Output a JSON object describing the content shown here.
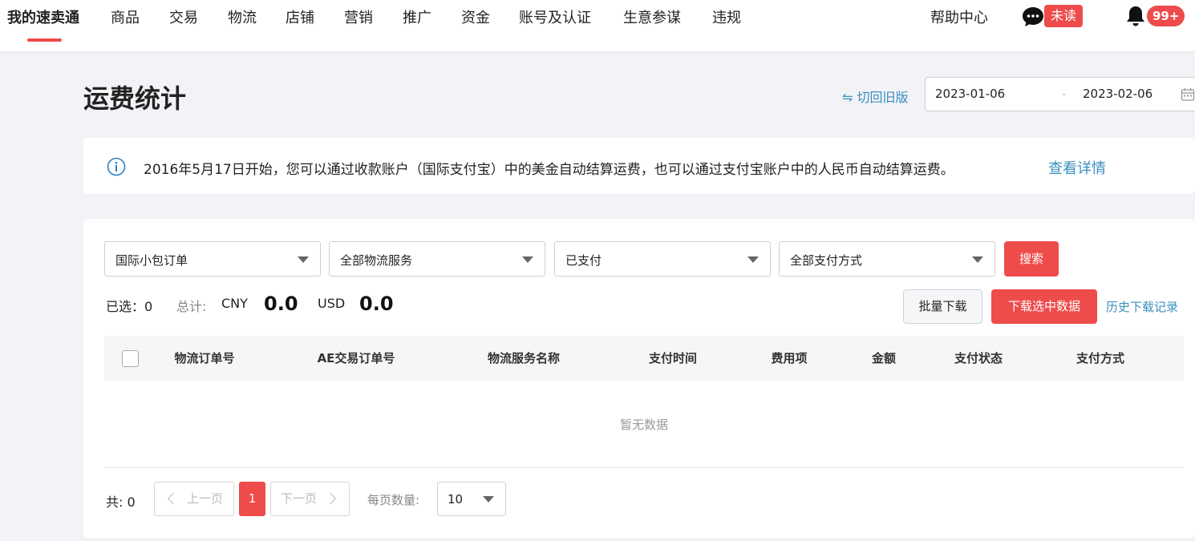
{
  "nav": {
    "items": [
      "我的速卖通",
      "商品",
      "交易",
      "物流",
      "店铺",
      "营销",
      "推广",
      "资金",
      "账号及认证",
      "生意参谋",
      "违规"
    ],
    "help": "帮助中心",
    "unread": "未读",
    "notif_count": "99+"
  },
  "header": {
    "title": "运费统计",
    "switch_link": "⇋ 切回旧版",
    "date_start": "2023-01-06",
    "date_sep": "-",
    "date_end": "2023-02-06"
  },
  "info": {
    "text": "2016年5月17日开始，您可以通过收款账户（国际支付宝）中的美金自动结算运费，也可以通过支付宝账户中的人民币自动结算运费。",
    "link": "查看详情"
  },
  "filters": {
    "order_type": "国际小包订单",
    "logistics_service": "全部物流服务",
    "pay_status": "已支付",
    "pay_method": "全部支付方式",
    "search": "搜索"
  },
  "summary": {
    "selected_label": "已选：",
    "selected_value": "0",
    "total_label": "总计:",
    "cny_label": "CNY",
    "cny_value": "0.0",
    "usd_label": "USD",
    "usd_value": "0.0"
  },
  "actions": {
    "batch_download": "批量下载",
    "download_selected": "下载选中数据",
    "history": "历史下载记录"
  },
  "table": {
    "columns": [
      "物流订单号",
      "AE交易订单号",
      "物流服务名称",
      "支付时间",
      "费用项",
      "金额",
      "支付状态",
      "支付方式"
    ],
    "empty": "暂无数据"
  },
  "pagination": {
    "total": "共: 0",
    "prev": "上一页",
    "current": "1",
    "next": "下一页",
    "per_page_label": "每页数量:",
    "per_page_value": "10"
  },
  "colors": {
    "accent": "#ee4b4b",
    "link": "#3a8fbf"
  }
}
